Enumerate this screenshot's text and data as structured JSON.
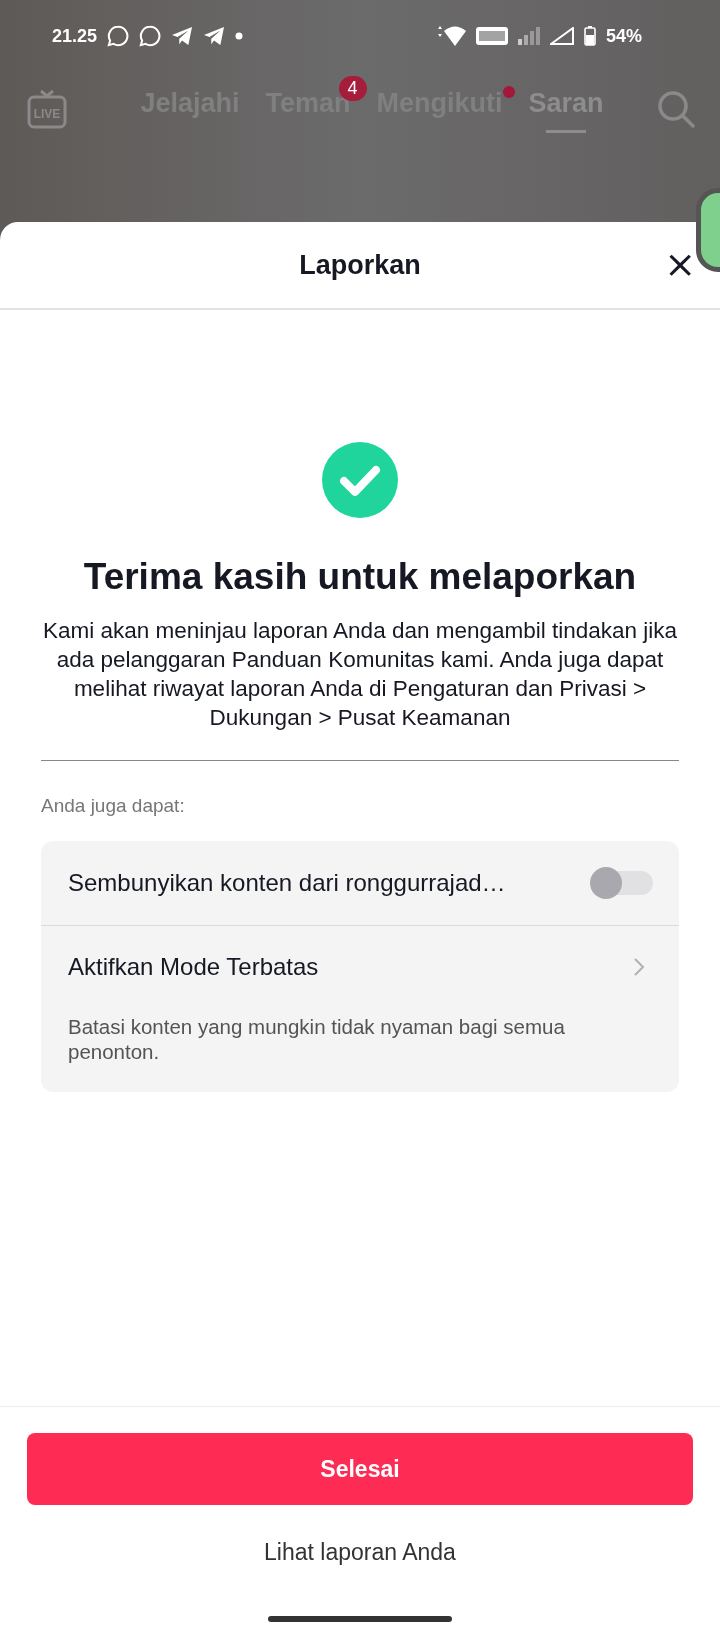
{
  "status_bar": {
    "time": "21.25",
    "battery": "54%"
  },
  "top_nav": {
    "live_label": "LIVE",
    "tabs": [
      {
        "label": "Jelajahi",
        "selected": false
      },
      {
        "label": "Teman",
        "selected": false,
        "badge": "4"
      },
      {
        "label": "Mengikuti",
        "selected": false,
        "dot": true
      },
      {
        "label": "Saran",
        "selected": true
      }
    ]
  },
  "sheet": {
    "title": "Laporkan",
    "close": "×",
    "heading": "Terima kasih untuk melaporkan",
    "message": "Kami akan meninjau laporan Anda dan mengambil tindakan jika ada pelanggaran Panduan Komunitas kami. Anda juga dapat melihat riwayat laporan Anda di Pengaturan dan Privasi > Dukungan > Pusat Keamanan",
    "section_label": "Anda juga dapat:",
    "options": [
      {
        "kind": "toggle",
        "label": "Sembunyikan konten dari ronggurrajad…",
        "on": false
      },
      {
        "kind": "link",
        "label": "Aktifkan Mode Terbatas",
        "description": "Batasi konten yang mungkin tidak nyaman bagi semua penonton."
      }
    ],
    "primary_button": "Selesai",
    "secondary_link": "Lihat laporan Anda"
  }
}
